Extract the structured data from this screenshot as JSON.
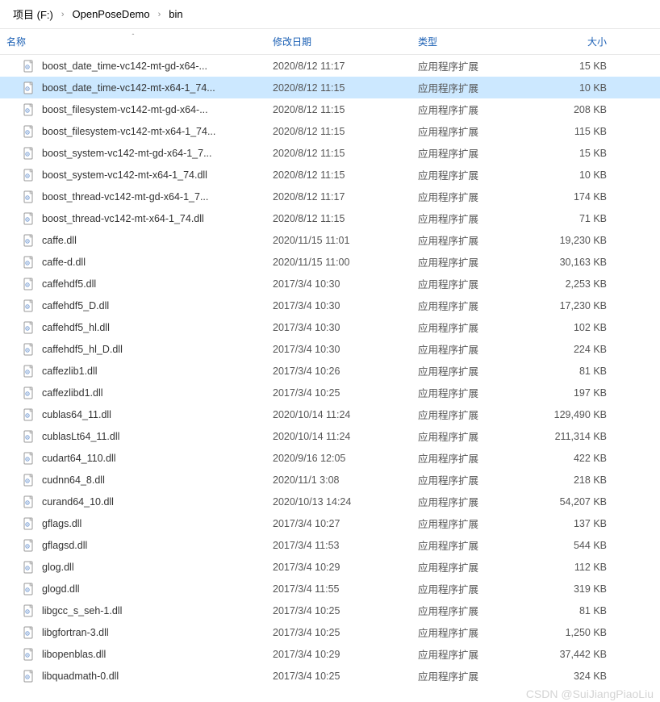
{
  "breadcrumb": {
    "items": [
      "项目 (F:)",
      "OpenPoseDemo",
      "bin"
    ],
    "separator": "›"
  },
  "columns": {
    "name": "名称",
    "date": "修改日期",
    "type": "类型",
    "size": "大小"
  },
  "sort_indicator": "ˆ",
  "files": [
    {
      "name": "boost_date_time-vc142-mt-gd-x64-...",
      "date": "2020/8/12 11:17",
      "type": "应用程序扩展",
      "size": "15 KB",
      "selected": false
    },
    {
      "name": "boost_date_time-vc142-mt-x64-1_74...",
      "date": "2020/8/12 11:15",
      "type": "应用程序扩展",
      "size": "10 KB",
      "selected": true
    },
    {
      "name": "boost_filesystem-vc142-mt-gd-x64-...",
      "date": "2020/8/12 11:15",
      "type": "应用程序扩展",
      "size": "208 KB",
      "selected": false
    },
    {
      "name": "boost_filesystem-vc142-mt-x64-1_74...",
      "date": "2020/8/12 11:15",
      "type": "应用程序扩展",
      "size": "115 KB",
      "selected": false
    },
    {
      "name": "boost_system-vc142-mt-gd-x64-1_7...",
      "date": "2020/8/12 11:15",
      "type": "应用程序扩展",
      "size": "15 KB",
      "selected": false
    },
    {
      "name": "boost_system-vc142-mt-x64-1_74.dll",
      "date": "2020/8/12 11:15",
      "type": "应用程序扩展",
      "size": "10 KB",
      "selected": false
    },
    {
      "name": "boost_thread-vc142-mt-gd-x64-1_7...",
      "date": "2020/8/12 11:17",
      "type": "应用程序扩展",
      "size": "174 KB",
      "selected": false
    },
    {
      "name": "boost_thread-vc142-mt-x64-1_74.dll",
      "date": "2020/8/12 11:15",
      "type": "应用程序扩展",
      "size": "71 KB",
      "selected": false
    },
    {
      "name": "caffe.dll",
      "date": "2020/11/15 11:01",
      "type": "应用程序扩展",
      "size": "19,230 KB",
      "selected": false
    },
    {
      "name": "caffe-d.dll",
      "date": "2020/11/15 11:00",
      "type": "应用程序扩展",
      "size": "30,163 KB",
      "selected": false
    },
    {
      "name": "caffehdf5.dll",
      "date": "2017/3/4 10:30",
      "type": "应用程序扩展",
      "size": "2,253 KB",
      "selected": false
    },
    {
      "name": "caffehdf5_D.dll",
      "date": "2017/3/4 10:30",
      "type": "应用程序扩展",
      "size": "17,230 KB",
      "selected": false
    },
    {
      "name": "caffehdf5_hl.dll",
      "date": "2017/3/4 10:30",
      "type": "应用程序扩展",
      "size": "102 KB",
      "selected": false
    },
    {
      "name": "caffehdf5_hl_D.dll",
      "date": "2017/3/4 10:30",
      "type": "应用程序扩展",
      "size": "224 KB",
      "selected": false
    },
    {
      "name": "caffezlib1.dll",
      "date": "2017/3/4 10:26",
      "type": "应用程序扩展",
      "size": "81 KB",
      "selected": false
    },
    {
      "name": "caffezlibd1.dll",
      "date": "2017/3/4 10:25",
      "type": "应用程序扩展",
      "size": "197 KB",
      "selected": false
    },
    {
      "name": "cublas64_11.dll",
      "date": "2020/10/14 11:24",
      "type": "应用程序扩展",
      "size": "129,490 KB",
      "selected": false
    },
    {
      "name": "cublasLt64_11.dll",
      "date": "2020/10/14 11:24",
      "type": "应用程序扩展",
      "size": "211,314 KB",
      "selected": false
    },
    {
      "name": "cudart64_110.dll",
      "date": "2020/9/16 12:05",
      "type": "应用程序扩展",
      "size": "422 KB",
      "selected": false
    },
    {
      "name": "cudnn64_8.dll",
      "date": "2020/11/1 3:08",
      "type": "应用程序扩展",
      "size": "218 KB",
      "selected": false
    },
    {
      "name": "curand64_10.dll",
      "date": "2020/10/13 14:24",
      "type": "应用程序扩展",
      "size": "54,207 KB",
      "selected": false
    },
    {
      "name": "gflags.dll",
      "date": "2017/3/4 10:27",
      "type": "应用程序扩展",
      "size": "137 KB",
      "selected": false
    },
    {
      "name": "gflagsd.dll",
      "date": "2017/3/4 11:53",
      "type": "应用程序扩展",
      "size": "544 KB",
      "selected": false
    },
    {
      "name": "glog.dll",
      "date": "2017/3/4 10:29",
      "type": "应用程序扩展",
      "size": "112 KB",
      "selected": false
    },
    {
      "name": "glogd.dll",
      "date": "2017/3/4 11:55",
      "type": "应用程序扩展",
      "size": "319 KB",
      "selected": false
    },
    {
      "name": "libgcc_s_seh-1.dll",
      "date": "2017/3/4 10:25",
      "type": "应用程序扩展",
      "size": "81 KB",
      "selected": false
    },
    {
      "name": "libgfortran-3.dll",
      "date": "2017/3/4 10:25",
      "type": "应用程序扩展",
      "size": "1,250 KB",
      "selected": false
    },
    {
      "name": "libopenblas.dll",
      "date": "2017/3/4 10:29",
      "type": "应用程序扩展",
      "size": "37,442 KB",
      "selected": false
    },
    {
      "name": "libquadmath-0.dll",
      "date": "2017/3/4 10:25",
      "type": "应用程序扩展",
      "size": "324 KB",
      "selected": false
    }
  ],
  "watermark": "CSDN @SuiJiangPiaoLiu"
}
